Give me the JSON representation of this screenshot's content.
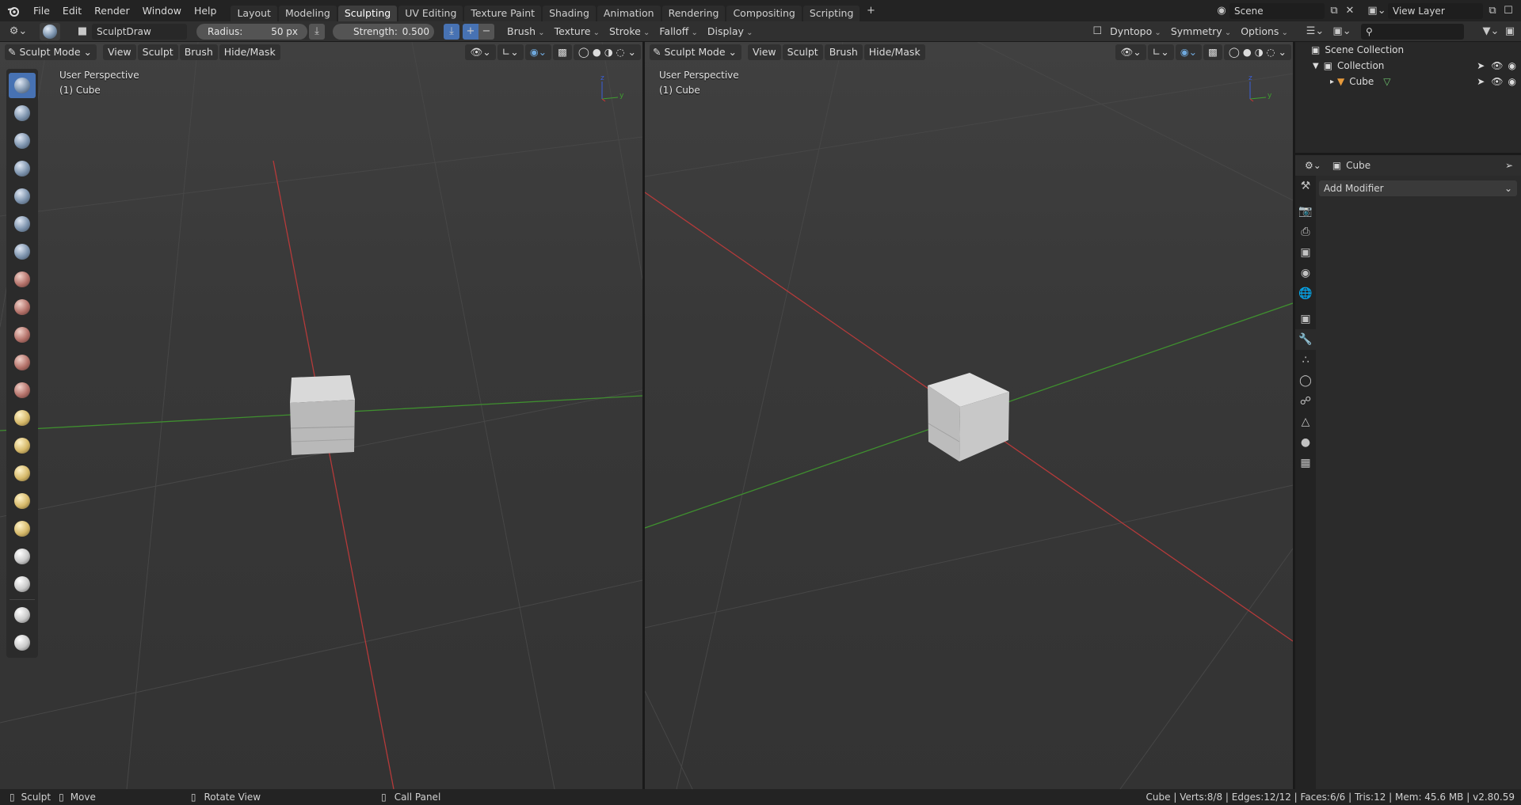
{
  "topbar": {
    "menus": [
      "File",
      "Edit",
      "Render",
      "Window",
      "Help"
    ],
    "workspaces": [
      "Layout",
      "Modeling",
      "Sculpting",
      "UV Editing",
      "Texture Paint",
      "Shading",
      "Animation",
      "Rendering",
      "Compositing",
      "Scripting"
    ],
    "active_workspace": "Sculpting",
    "scene": "Scene",
    "view_layer": "View Layer"
  },
  "tool_settings": {
    "brush_name": "SculptDraw",
    "radius_label": "Radius:",
    "radius_value": "50 px",
    "strength_label": "Strength:",
    "strength_value": "0.500",
    "menus": [
      "Brush",
      "Texture",
      "Stroke",
      "Falloff",
      "Display"
    ],
    "dyntopo": "Dyntopo",
    "symmetry": "Symmetry",
    "options": "Options"
  },
  "viewport_left": {
    "mode": "Sculpt Mode",
    "menus": [
      "View",
      "Sculpt",
      "Brush",
      "Hide/Mask"
    ],
    "perspective": "User Perspective",
    "object": "(1) Cube"
  },
  "viewport_right": {
    "mode": "Sculpt Mode",
    "menus": [
      "View",
      "Sculpt",
      "Brush",
      "Hide/Mask"
    ],
    "perspective": "User Perspective",
    "object": "(1) Cube"
  },
  "tools": [
    {
      "icon": "draw-brush-icon",
      "style": "blue",
      "active": true
    },
    {
      "icon": "draw-sharp-brush-icon",
      "style": "blue"
    },
    {
      "icon": "clay-brush-icon",
      "style": "blue"
    },
    {
      "icon": "clay-strips-brush-icon",
      "style": "blue"
    },
    {
      "icon": "layer-brush-icon",
      "style": "blue"
    },
    {
      "icon": "inflate-brush-icon",
      "style": "blue"
    },
    {
      "icon": "blob-brush-icon",
      "style": "blue"
    },
    {
      "icon": "crease-brush-icon",
      "style": "red"
    },
    {
      "icon": "smooth-brush-icon",
      "style": "red"
    },
    {
      "icon": "flatten-brush-icon",
      "style": "red"
    },
    {
      "icon": "fill-brush-icon",
      "style": "red"
    },
    {
      "icon": "scrape-brush-icon",
      "style": "red"
    },
    {
      "icon": "pinch-brush-icon",
      "style": "yel"
    },
    {
      "icon": "grab-brush-icon",
      "style": "yel"
    },
    {
      "icon": "snake-hook-brush-icon",
      "style": "yel"
    },
    {
      "icon": "thumb-brush-icon",
      "style": "yel"
    },
    {
      "icon": "nudge-brush-icon",
      "style": "yel"
    },
    {
      "icon": "rotate-brush-icon",
      "style": "wh"
    },
    {
      "icon": "simplify-brush-icon",
      "style": "wh"
    },
    {
      "icon": "box-mask-icon",
      "style": "wh"
    },
    {
      "icon": "box-hide-icon",
      "style": "wh"
    }
  ],
  "outliner": {
    "scene_collection": "Scene Collection",
    "collection": "Collection",
    "object": "Cube"
  },
  "properties": {
    "object": "Cube",
    "add_modifier": "Add Modifier",
    "tabs": [
      "tool-icon",
      "render-icon",
      "output-icon",
      "view-layer-icon",
      "scene-icon",
      "world-icon",
      "object-icon",
      "modifier-wrench-icon",
      "particles-icon",
      "physics-icon",
      "constraints-icon",
      "object-data-icon",
      "material-icon",
      "texture-icon"
    ]
  },
  "statusbar": {
    "sculpt": "Sculpt",
    "move": "Move",
    "rotate": "Rotate View",
    "call_panel": "Call Panel",
    "stats": "Cube | Verts:8/8 | Edges:12/12 | Faces:6/6 | Tris:12 | Mem: 45.6 MB | v2.80.59"
  },
  "colors": {
    "accent": "#4772b3",
    "x_axis": "#b53a3a",
    "y_axis": "#3f8f2f",
    "bg": "#3c3c3c"
  }
}
